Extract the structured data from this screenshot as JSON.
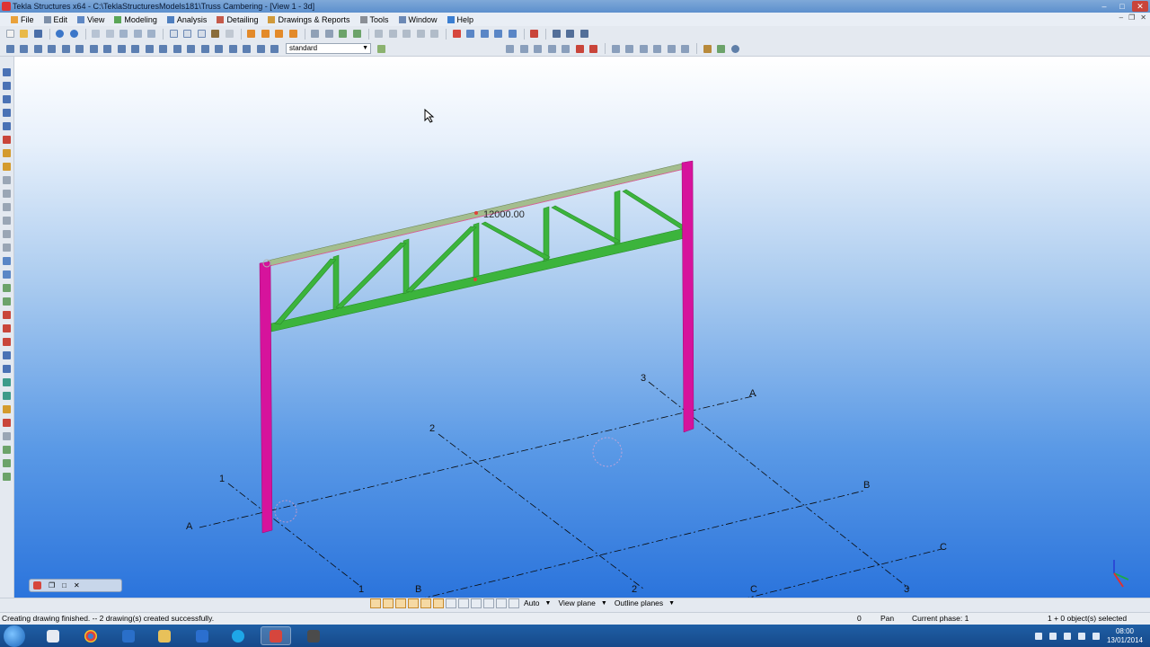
{
  "window": {
    "title": "Tekla Structures x64 - C:\\TeklaStructuresModels181\\Truss Cambering - [View 1 - 3d]"
  },
  "menu": {
    "items": [
      "File",
      "Edit",
      "View",
      "Modeling",
      "Analysis",
      "Detailing",
      "Drawings & Reports",
      "Tools",
      "Window",
      "Help"
    ]
  },
  "toolbar": {
    "view_combo_value": "standard"
  },
  "model": {
    "dimension_label": "12000.00",
    "grid_labels": {
      "top_3": "3",
      "top_A": "A",
      "mid_2": "2",
      "left_1": "1",
      "left_A": "A",
      "right_B": "B",
      "right_C": "C",
      "bottom_1": "1",
      "bottom_B": "B",
      "bottom_2": "2",
      "bottom_C": "C",
      "bottom_3": "3"
    },
    "colors": {
      "columns": "#d6139c",
      "truss": "#3cb43c",
      "top_chord": "#9fb88a",
      "background_top": "#ffffff",
      "background_bottom": "#2b74dc"
    }
  },
  "view_toolbar": {
    "auto_label": "Auto",
    "view_plane_label": "View plane",
    "outline_planes_label": "Outline planes"
  },
  "status": {
    "message": "Creating drawing finished. -- 2 drawing(s) created successfully.",
    "counter": "0",
    "mode": "Pan",
    "phase": "Current phase: 1",
    "selection": "1 + 0 object(s) selected"
  },
  "taskbar": {
    "time": "08:00",
    "date": "13/01/2014"
  }
}
